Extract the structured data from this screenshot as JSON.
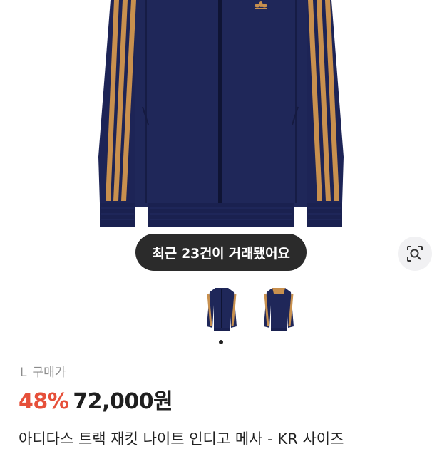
{
  "product": {
    "trade_badge": "최근 23건이 거래됐어요",
    "size": "L",
    "price_type": "구매가",
    "discount": "48%",
    "price": "72,000원",
    "title": "아디다스 트랙 재킷 나이트 인디고 메사 - KR 사이즈"
  },
  "gallery": {
    "thumbnail_count": 2,
    "active_index": 0,
    "main_image": "navy-track-jacket-with-tan-stripes"
  },
  "icons": {
    "lens": "image-search-icon",
    "brand": "trefoil-logo-icon"
  },
  "colors": {
    "jacket": "#1d2456",
    "stripe": "#c8904e",
    "discount": "#e6503a",
    "pill": "#2b2b2b"
  }
}
